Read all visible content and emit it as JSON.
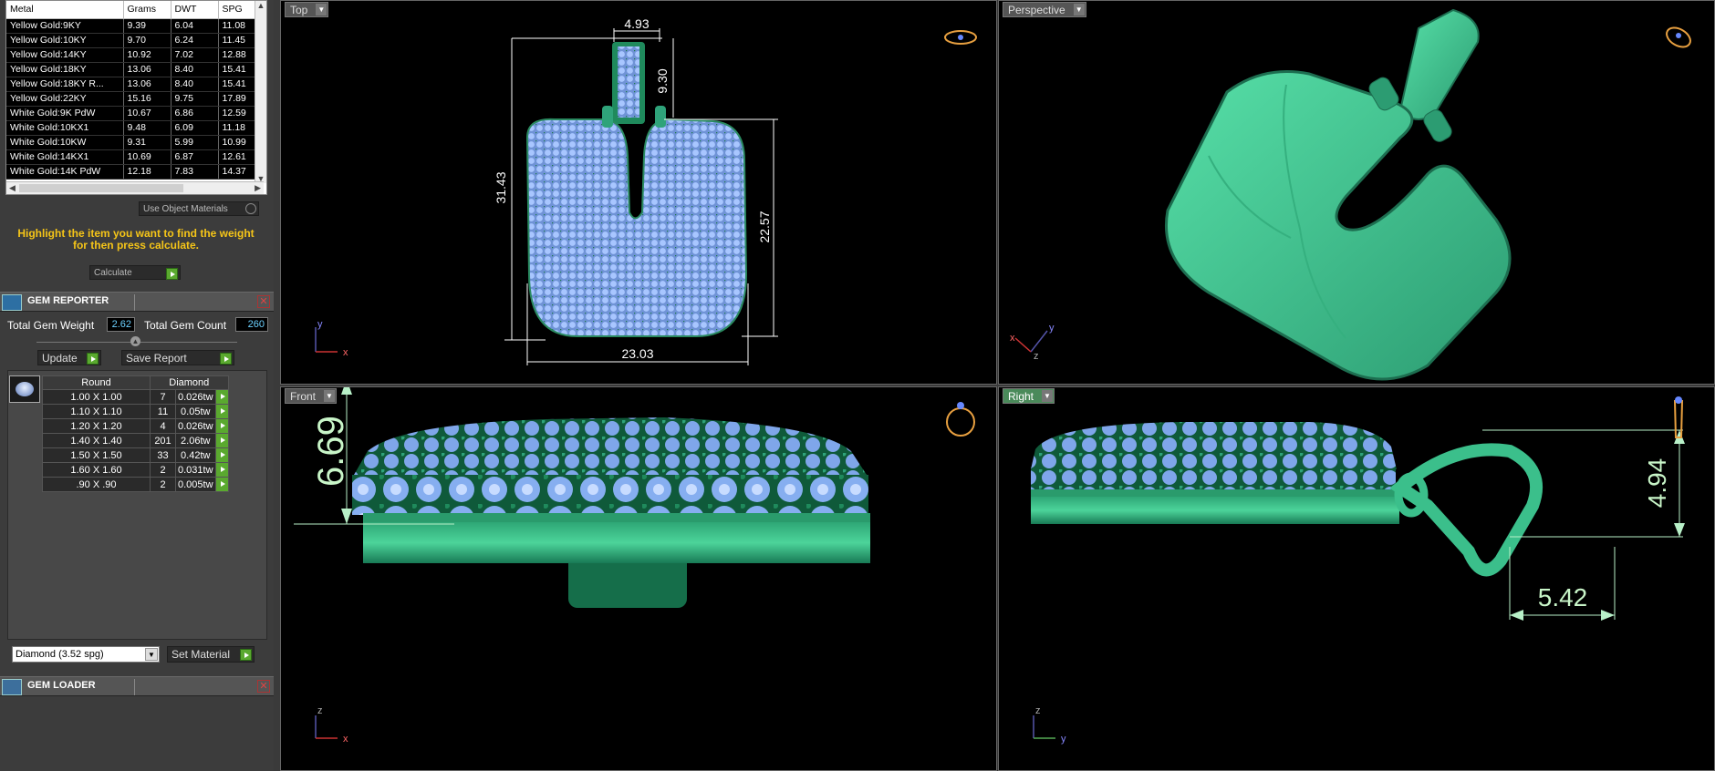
{
  "metal_table": {
    "headers": [
      "Metal",
      "Grams",
      "DWT",
      "SPG"
    ],
    "rows": [
      [
        "Yellow Gold:9KY",
        "9.39",
        "6.04",
        "11.08"
      ],
      [
        "Yellow Gold:10KY",
        "9.70",
        "6.24",
        "11.45"
      ],
      [
        "Yellow Gold:14KY",
        "10.92",
        "7.02",
        "12.88"
      ],
      [
        "Yellow Gold:18KY",
        "13.06",
        "8.40",
        "15.41"
      ],
      [
        "Yellow Gold:18KY R...",
        "13.06",
        "8.40",
        "15.41"
      ],
      [
        "Yellow Gold:22KY",
        "15.16",
        "9.75",
        "17.89"
      ],
      [
        "White Gold:9K PdW",
        "10.67",
        "6.86",
        "12.59"
      ],
      [
        "White Gold:10KX1",
        "9.48",
        "6.09",
        "11.18"
      ],
      [
        "White Gold:10KW",
        "9.31",
        "5.99",
        "10.99"
      ],
      [
        "White Gold:14KX1",
        "10.69",
        "6.87",
        "12.61"
      ],
      [
        "White Gold:14K PdW",
        "12.18",
        "7.83",
        "14.37"
      ]
    ]
  },
  "use_object_materials": "Use Object Materials",
  "hint": "Highlight the item you want to find the weight for then press calculate.",
  "calculate_label": "Calculate",
  "gem_reporter": {
    "title": "GEM REPORTER",
    "total_weight_label": "Total Gem Weight",
    "total_weight": "2.62",
    "total_count_label": "Total Gem Count",
    "total_count": "260",
    "update_label": "Update",
    "save_label": "Save Report",
    "col_shape": "Round",
    "col_material": "Diamond",
    "rows": [
      [
        "1.00 X 1.00",
        "7",
        "0.026tw"
      ],
      [
        "1.10 X 1.10",
        "11",
        "0.05tw"
      ],
      [
        "1.20 X 1.20",
        "4",
        "0.026tw"
      ],
      [
        "1.40 X 1.40",
        "201",
        "2.06tw"
      ],
      [
        "1.50 X 1.50",
        "33",
        "0.42tw"
      ],
      [
        "1.60 X 1.60",
        "2",
        "0.031tw"
      ],
      [
        ".90 X .90",
        "2",
        "0.005tw"
      ]
    ],
    "material_select": "Diamond   (3.52 spg)",
    "set_material_label": "Set Material"
  },
  "gem_loader": {
    "title": "GEM LOADER"
  },
  "viewports": {
    "top": {
      "label": "Top",
      "dims": {
        "w_bail": "4.93",
        "h_bail": "9.30",
        "h_total": "31.43",
        "h_body": "22.57",
        "w_body": "23.03"
      }
    },
    "perspective": {
      "label": "Perspective"
    },
    "front": {
      "label": "Front",
      "dim": "6.69"
    },
    "right": {
      "label": "Right",
      "dims": {
        "h": "4.94",
        "w": "5.42"
      }
    }
  },
  "axes": {
    "x": "x",
    "y": "y",
    "z": "z"
  },
  "colors": {
    "metal": "#2fa37a",
    "gem": "#8fb4f0",
    "dim_line": "#ffffff",
    "dim_text_big": "#c8f5c8",
    "hint": "#f5c518"
  }
}
